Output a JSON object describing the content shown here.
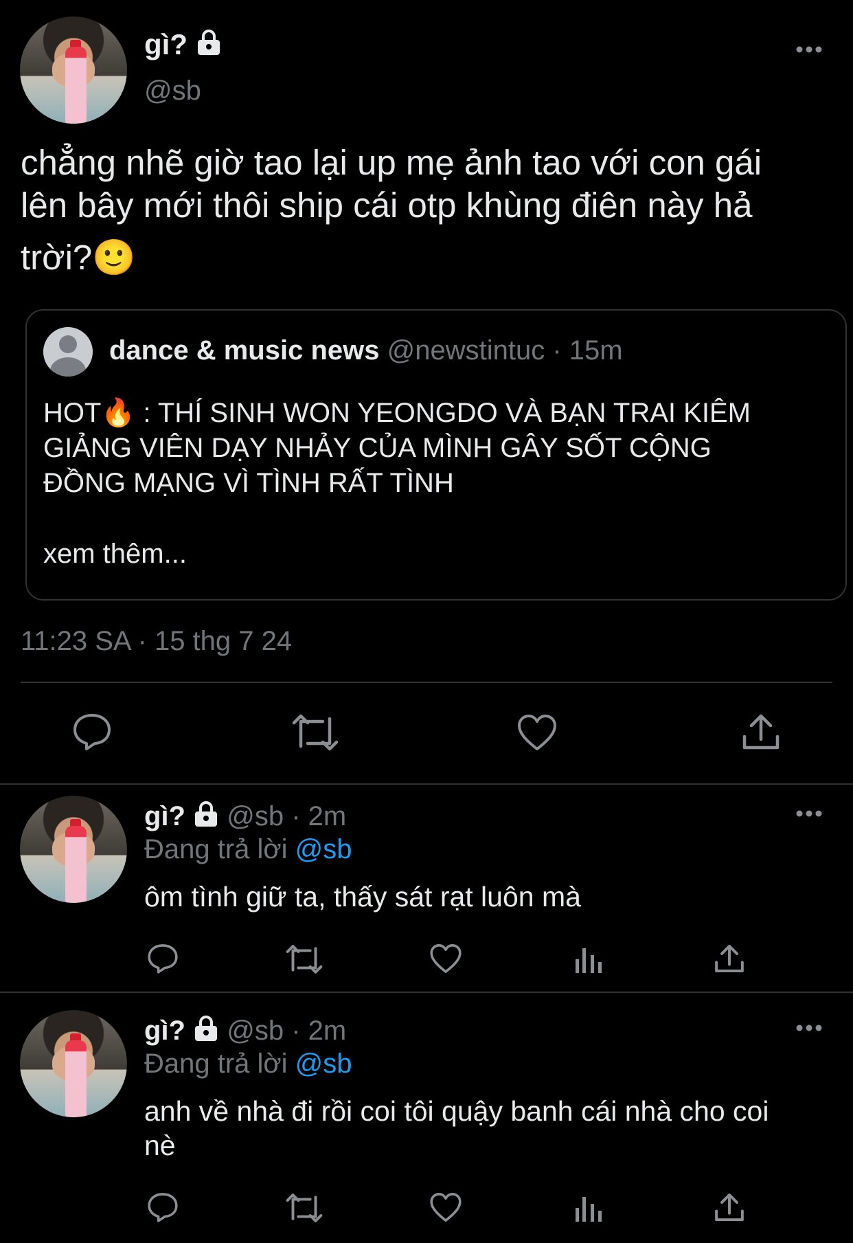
{
  "main_tweet": {
    "display_name": "gì?",
    "handle": "@sb",
    "text_line1": "chẳng nhẽ giờ tao lại up mẹ ảnh tao với con gái",
    "text_line2": "lên bây mới thôi ship cái otp khùng điên này hả",
    "text_line3": "trời?🙂",
    "timestamp": "11:23 SA · 15 thg 7 24"
  },
  "quoted_tweet": {
    "display_name": "dance & music news",
    "handle": "@newstintuc",
    "time": "· 15m",
    "text_line1": "HOT🔥 : THÍ SINH WON YEONGDO VÀ BẠN TRAI KIÊM",
    "text_line2": "GIẢNG VIÊN DẠY NHẢY CỦA MÌNH GÂY SỐT CỘNG",
    "text_line3": "ĐỒNG MẠNG VÌ TÌNH RẤT TÌNH",
    "see_more": "xem thêm..."
  },
  "replies": [
    {
      "display_name": "gì?",
      "handle": "@sb",
      "time": "· 2m",
      "replying_prefix": "Đang trả lời",
      "replying_to": "@sb",
      "text_line1": "ôm tình giữ ta, thấy sát rạt luôn mà",
      "text_line2": ""
    },
    {
      "display_name": "gì?",
      "handle": "@sb",
      "time": "· 2m",
      "replying_prefix": "Đang trả lời",
      "replying_to": "@sb",
      "text_line1": "anh về nhà đi rồi coi tôi quậy banh cái nhà cho coi",
      "text_line2": "nè"
    }
  ],
  "icons": [
    "more-icon",
    "lock-icon",
    "reply-icon",
    "retweet-icon",
    "like-icon",
    "views-icon",
    "share-icon"
  ],
  "colors": {
    "background": "#000000",
    "text": "#e7e9ea",
    "muted": "#71767b",
    "link": "#1d9bf0",
    "border": "#2f3336"
  }
}
